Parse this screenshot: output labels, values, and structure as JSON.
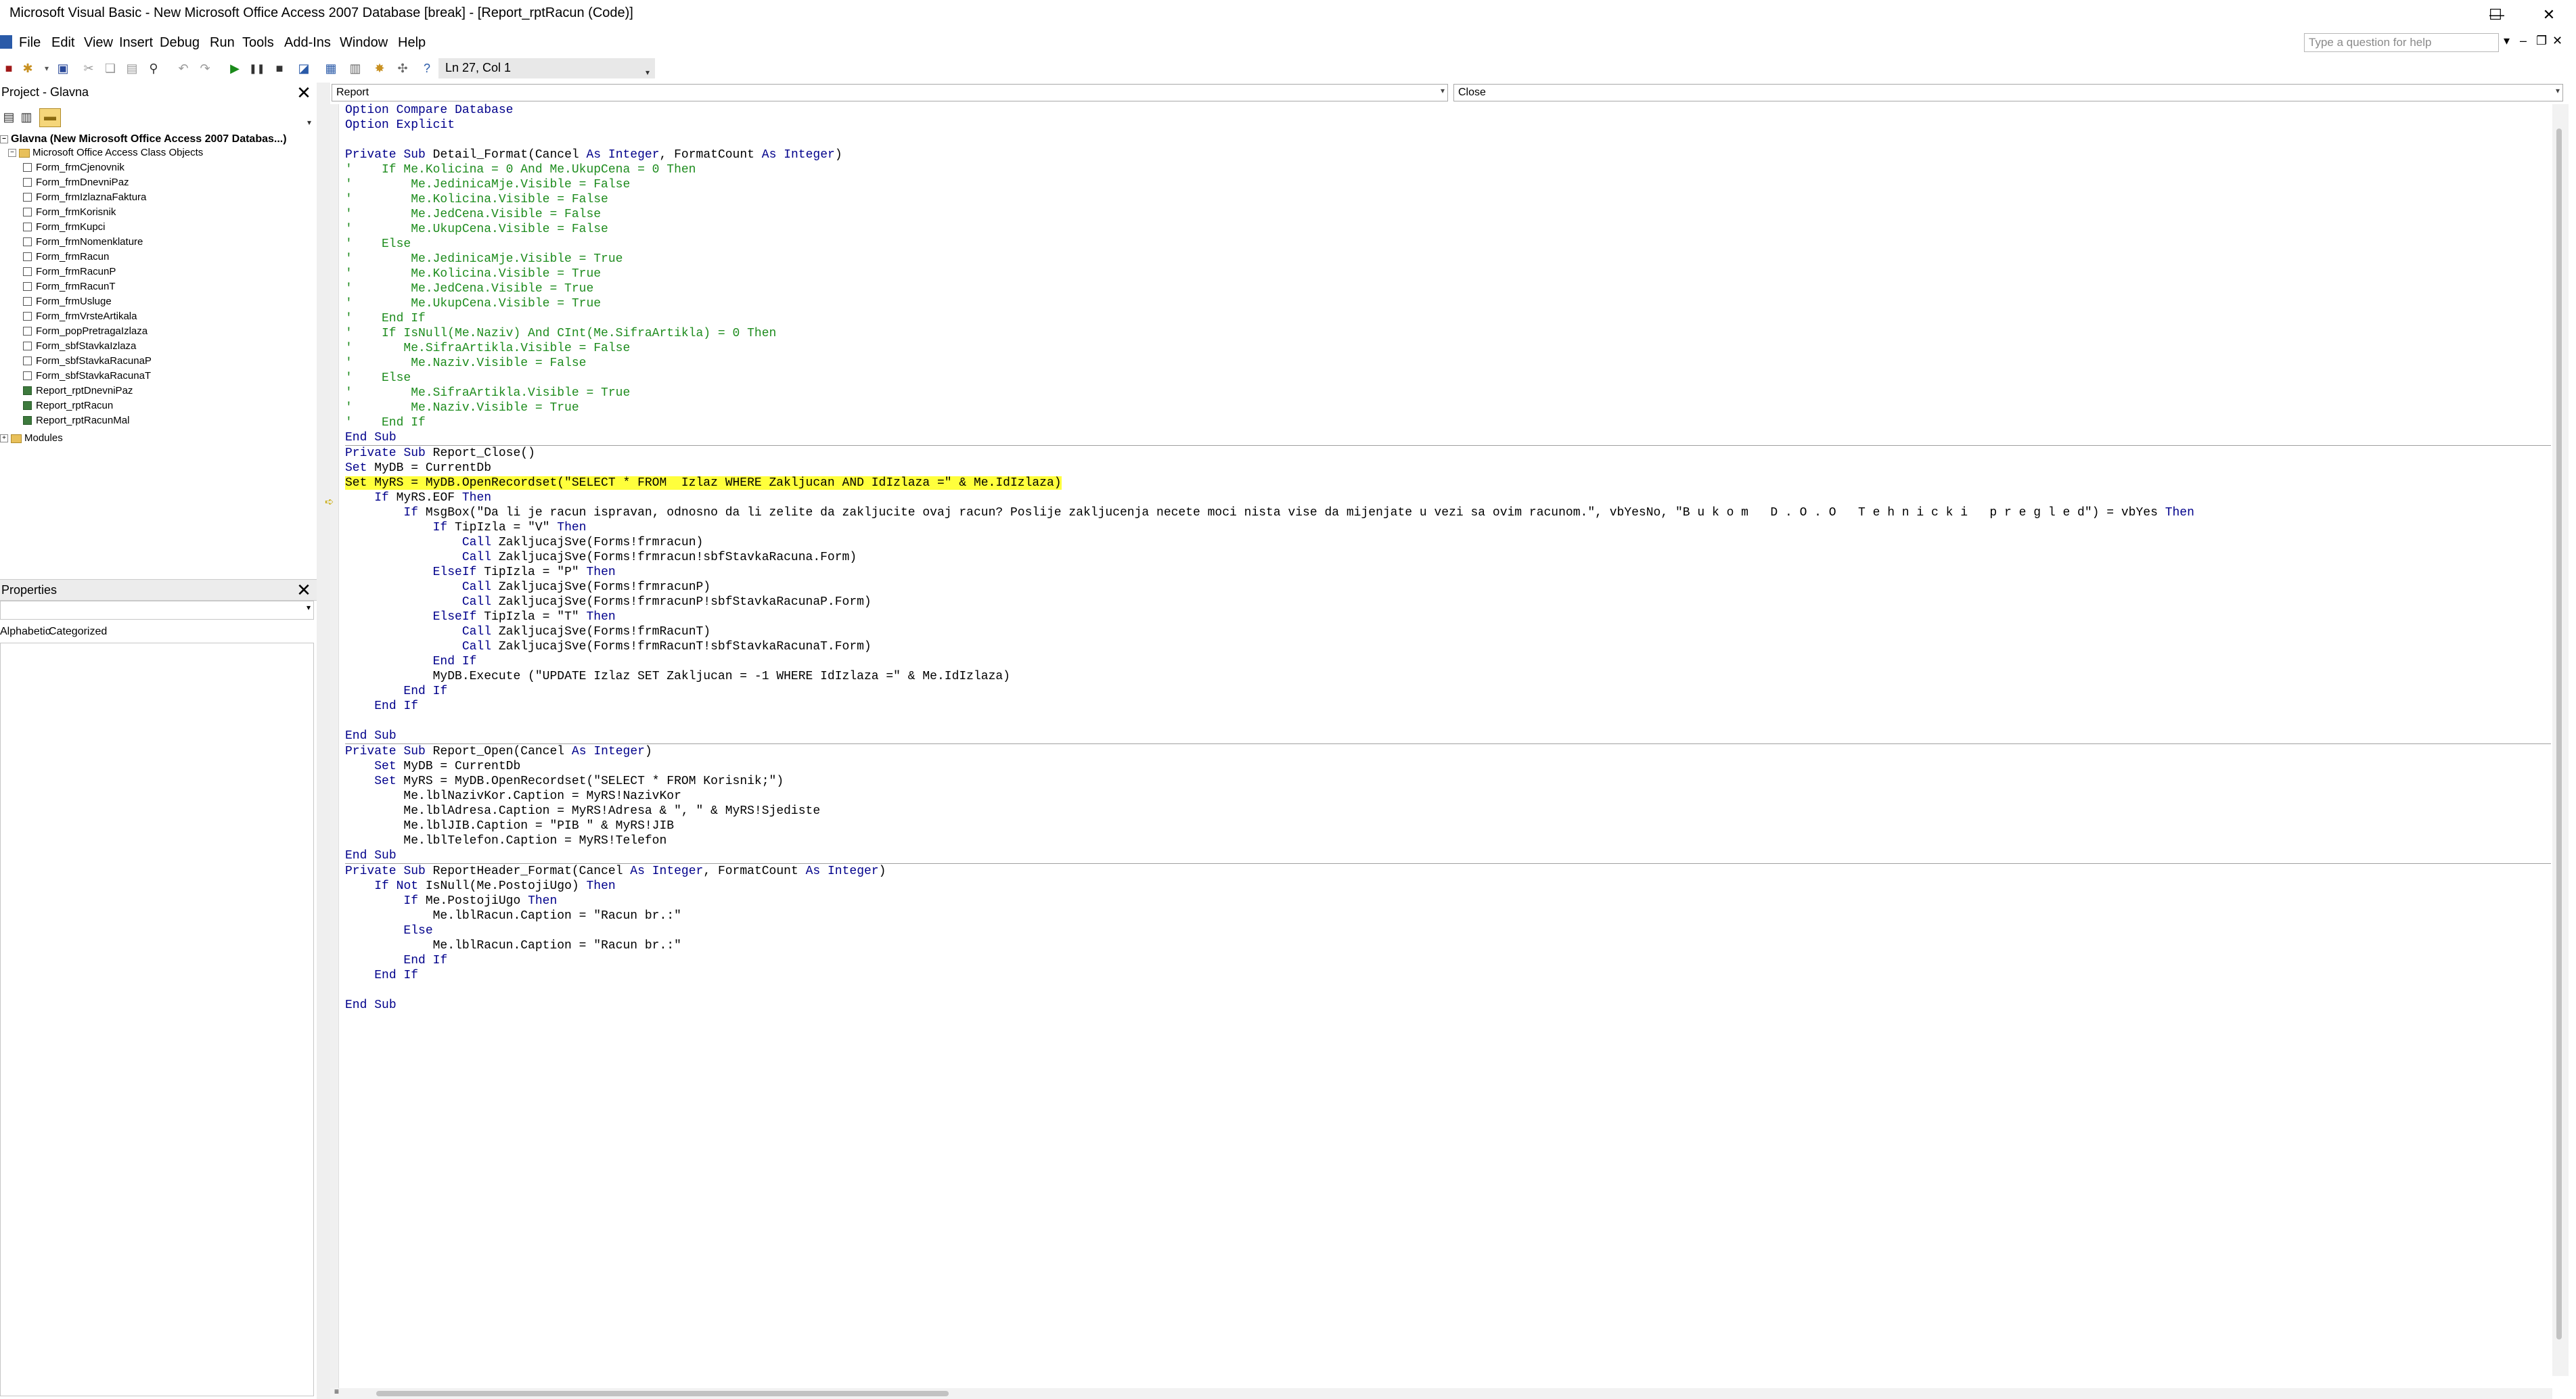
{
  "window": {
    "title": "Microsoft Visual Basic - New Microsoft Office Access 2007 Database [break] - [Report_rptRacun (Code)]",
    "minimize": "—",
    "maximize": "☐",
    "close": "✕"
  },
  "menu": {
    "items": [
      "File",
      "Edit",
      "View",
      "Insert",
      "Debug",
      "Run",
      "Tools",
      "Add-Ins",
      "Window",
      "Help"
    ],
    "help_placeholder": "Type a question for help"
  },
  "toolbar": {
    "position": "Ln 27, Col 1",
    "icons": [
      "access-icon",
      "insert-module-icon",
      "save-icon",
      "cut-icon",
      "copy-icon",
      "paste-icon",
      "find-icon",
      "undo-icon",
      "redo-icon",
      "run-icon",
      "break-icon",
      "reset-icon",
      "design-mode-icon",
      "project-explorer-icon",
      "properties-icon",
      "object-browser-icon",
      "toolbox-icon",
      "help-icon"
    ]
  },
  "project": {
    "title": "Project - Glavna",
    "root": "Glavna (New Microsoft Office Access 2007 Databas...)",
    "class_folder": "Microsoft Office Access Class Objects",
    "items": [
      {
        "name": "Form_frmCjenovnik",
        "kind": "form"
      },
      {
        "name": "Form_frmDnevniPaz",
        "kind": "form"
      },
      {
        "name": "Form_frmIzlaznaFaktura",
        "kind": "form"
      },
      {
        "name": "Form_frmKorisnik",
        "kind": "form"
      },
      {
        "name": "Form_frmKupci",
        "kind": "form"
      },
      {
        "name": "Form_frmNomenklature",
        "kind": "form"
      },
      {
        "name": "Form_frmRacun",
        "kind": "form"
      },
      {
        "name": "Form_frmRacunP",
        "kind": "form"
      },
      {
        "name": "Form_frmRacunT",
        "kind": "form"
      },
      {
        "name": "Form_frmUsluge",
        "kind": "form"
      },
      {
        "name": "Form_frmVrsteArtikala",
        "kind": "form"
      },
      {
        "name": "Form_popPretragaIzlaza",
        "kind": "form"
      },
      {
        "name": "Form_sbfStavkaIzlaza",
        "kind": "form"
      },
      {
        "name": "Form_sbfStavkaRacunaP",
        "kind": "form"
      },
      {
        "name": "Form_sbfStavkaRacunaT",
        "kind": "form"
      },
      {
        "name": "Report_rptDnevniPaz",
        "kind": "report"
      },
      {
        "name": "Report_rptRacun",
        "kind": "report"
      },
      {
        "name": "Report_rptRacunMal",
        "kind": "report"
      }
    ],
    "modules_folder": "Modules"
  },
  "properties": {
    "title": "Properties",
    "tab_alpha": "Alphabetic",
    "tab_cat": "Categorized"
  },
  "code_window": {
    "object_combo": "Report",
    "proc_combo": "Close",
    "lines": [
      {
        "t": "Option Compare Database",
        "c": "kw"
      },
      {
        "t": "Option Explicit",
        "c": "kw"
      },
      {
        "t": "",
        "c": ""
      },
      {
        "t": "Private Sub Detail_Format(Cancel As Integer, FormatCount As Integer)",
        "c": "mix1"
      },
      {
        "t": "'    If Me.Kolicina = 0 And Me.UkupCena = 0 Then",
        "c": "cm"
      },
      {
        "t": "'        Me.JedinicaMje.Visible = False",
        "c": "cm"
      },
      {
        "t": "'        Me.Kolicina.Visible = False",
        "c": "cm"
      },
      {
        "t": "'        Me.JedCena.Visible = False",
        "c": "cm"
      },
      {
        "t": "'        Me.UkupCena.Visible = False",
        "c": "cm"
      },
      {
        "t": "'    Else",
        "c": "cm"
      },
      {
        "t": "'        Me.JedinicaMje.Visible = True",
        "c": "cm"
      },
      {
        "t": "'        Me.Kolicina.Visible = True",
        "c": "cm"
      },
      {
        "t": "'        Me.JedCena.Visible = True",
        "c": "cm"
      },
      {
        "t": "'        Me.UkupCena.Visible = True",
        "c": "cm"
      },
      {
        "t": "'    End If",
        "c": "cm"
      },
      {
        "t": "'    If IsNull(Me.Naziv) And CInt(Me.SifraArtikla) = 0 Then",
        "c": "cm"
      },
      {
        "t": "'       Me.SifraArtikla.Visible = False",
        "c": "cm"
      },
      {
        "t": "'        Me.Naziv.Visible = False",
        "c": "cm"
      },
      {
        "t": "'    Else",
        "c": "cm"
      },
      {
        "t": "'        Me.SifraArtikla.Visible = True",
        "c": "cm"
      },
      {
        "t": "'        Me.Naziv.Visible = True",
        "c": "cm"
      },
      {
        "t": "'    End If",
        "c": "cm"
      },
      {
        "t": "End Sub",
        "c": "kw"
      },
      {
        "t": "---",
        "c": "sep"
      },
      {
        "t": "Private Sub Report_Close()",
        "c": "mix2"
      },
      {
        "t": "Set MyDB = CurrentDb",
        "c": "mix3"
      },
      {
        "t": "Set MyRS = MyDB.OpenRecordset(\"SELECT * FROM  Izlaz WHERE Zakljucan AND IdIzlaza =\" & Me.IdIzlaza)",
        "c": "hl"
      },
      {
        "t": "    If MyRS.EOF Then",
        "c": "mix4"
      },
      {
        "t": "        If MsgBox(\"Da li je racun ispravan, odnosno da li zelite da zakljucite ovaj racun? Poslije zakljucenja necete moci nista vise da mijenjate u vezi sa ovim racunom.\", vbYesNo, \"B u k o m   D . O . O   T e h n i c k i   p r e g l e d\") = vbYes Then",
        "c": "mix5"
      },
      {
        "t": "            If TipIzla = \"V\" Then",
        "c": "mix6"
      },
      {
        "t": "                Call ZakljucajSve(Forms!frmracun)",
        "c": "mix7"
      },
      {
        "t": "                Call ZakljucajSve(Forms!frmracun!sbfStavkaRacuna.Form)",
        "c": "mix7"
      },
      {
        "t": "            ElseIf TipIzla = \"P\" Then",
        "c": "mix8"
      },
      {
        "t": "                Call ZakljucajSve(Forms!frmracunP)",
        "c": "mix7"
      },
      {
        "t": "                Call ZakljucajSve(Forms!frmracunP!sbfStavkaRacunaP.Form)",
        "c": "mix7"
      },
      {
        "t": "            ElseIf TipIzla = \"T\" Then",
        "c": "mix8"
      },
      {
        "t": "                Call ZakljucajSve(Forms!frmRacunT)",
        "c": "mix7"
      },
      {
        "t": "                Call ZakljucajSve(Forms!frmRacunT!sbfStavkaRacunaT.Form)",
        "c": "mix7"
      },
      {
        "t": "            End If",
        "c": "kw"
      },
      {
        "t": "            MyDB.Execute (\"UPDATE Izlaz SET Zakljucan = -1 WHERE IdIzlaza =\" & Me.IdIzlaza)",
        "c": ""
      },
      {
        "t": "        End If",
        "c": "kw"
      },
      {
        "t": "    End If",
        "c": "kw"
      },
      {
        "t": "",
        "c": ""
      },
      {
        "t": "End Sub",
        "c": "kw"
      },
      {
        "t": "---",
        "c": "sep"
      },
      {
        "t": "Private Sub Report_Open(Cancel As Integer)",
        "c": "mix9"
      },
      {
        "t": "    Set MyDB = CurrentDb",
        "c": "mix3"
      },
      {
        "t": "    Set MyRS = MyDB.OpenRecordset(\"SELECT * FROM Korisnik;\")",
        "c": "mix3"
      },
      {
        "t": "        Me.lblNazivKor.Caption = MyRS!NazivKor",
        "c": ""
      },
      {
        "t": "        Me.lblAdresa.Caption = MyRS!Adresa & \", \" & MyRS!Sjediste",
        "c": ""
      },
      {
        "t": "        Me.lblJIB.Caption = \"PIB \" & MyRS!JIB",
        "c": ""
      },
      {
        "t": "        Me.lblTelefon.Caption = MyRS!Telefon",
        "c": ""
      },
      {
        "t": "End Sub",
        "c": "kw"
      },
      {
        "t": "---",
        "c": "sep"
      },
      {
        "t": "Private Sub ReportHeader_Format(Cancel As Integer, FormatCount As Integer)",
        "c": "mix1"
      },
      {
        "t": "    If Not IsNull(Me.PostojiUgo) Then",
        "c": "mix10"
      },
      {
        "t": "        If Me.PostojiUgo Then",
        "c": "mix4"
      },
      {
        "t": "            Me.lblRacun.Caption = \"Racun br.:\"",
        "c": ""
      },
      {
        "t": "        Else",
        "c": "kw"
      },
      {
        "t": "            Me.lblRacun.Caption = \"Racun br.:\"",
        "c": ""
      },
      {
        "t": "        End If",
        "c": "kw"
      },
      {
        "t": "    End If",
        "c": "kw"
      },
      {
        "t": "",
        "c": ""
      },
      {
        "t": "End Sub",
        "c": "kw"
      }
    ]
  },
  "colors": {
    "keyword": "#00008b",
    "comment": "#1e8c1e",
    "highlight": "#ffff3c"
  }
}
